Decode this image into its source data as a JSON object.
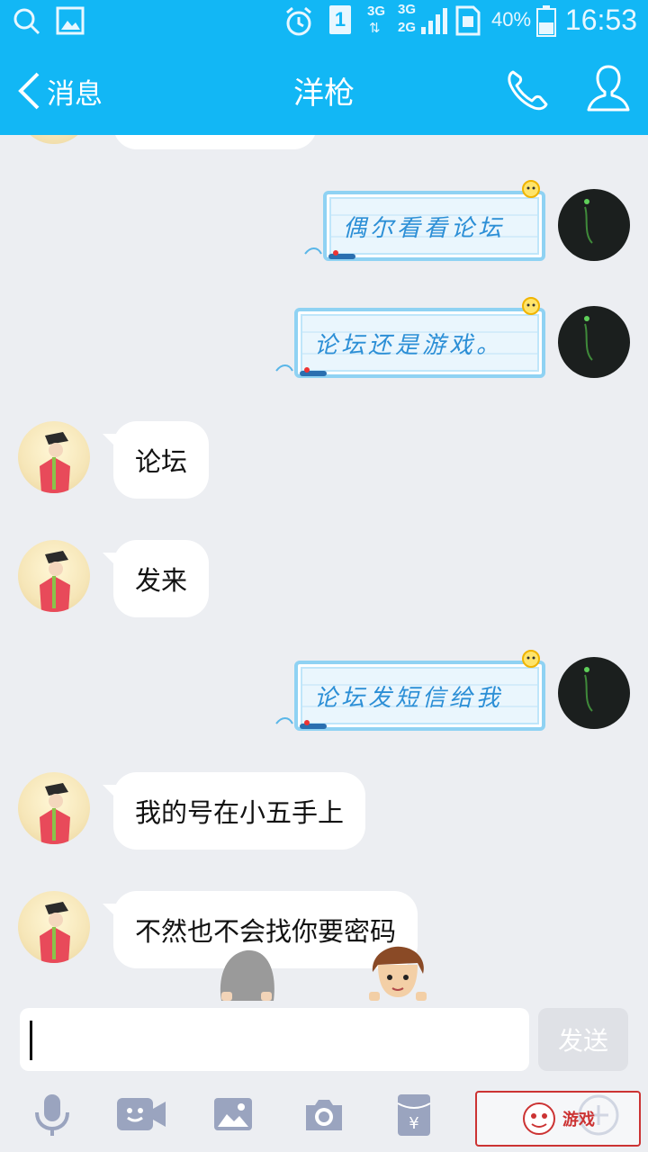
{
  "status_bar": {
    "battery_pct": "40%",
    "time": "16:53",
    "sim_slot": "1",
    "network_top": "3G",
    "network_bottom": "3G",
    "network_bottom2": "2G"
  },
  "header": {
    "back_label": "消息",
    "title": "洋枪"
  },
  "messages": [
    {
      "side": "right",
      "text": "偶尔看看论坛"
    },
    {
      "side": "right",
      "text": "论坛还是游戏。"
    },
    {
      "side": "left",
      "text": "论坛"
    },
    {
      "side": "left",
      "text": "发来"
    },
    {
      "side": "right",
      "text": "论坛发短信给我"
    },
    {
      "side": "left",
      "text": "我的号在小五手上"
    },
    {
      "side": "left",
      "text": "不然也不会找你要密码"
    }
  ],
  "composer": {
    "input_value": "",
    "send_label": "发送"
  },
  "toolbar": {
    "items": [
      "mic-icon",
      "video-icon",
      "image-icon",
      "camera-icon",
      "red-packet-icon",
      "more-icon"
    ]
  },
  "watermark": {
    "text": "游戏"
  },
  "colors": {
    "accent": "#12b7f5",
    "background": "#eceef2",
    "bubble_text_right": "#2c8fd6"
  }
}
